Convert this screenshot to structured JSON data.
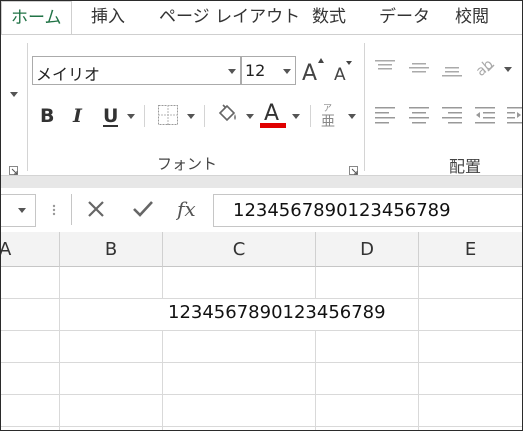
{
  "tabs": [
    "ホーム",
    "挿入",
    "ページ レイアウト",
    "数式",
    "データ",
    "校閲"
  ],
  "font_group": {
    "font_name": "メイリオ",
    "font_size": "12",
    "label": "フォント",
    "underline_color": "#e00000"
  },
  "alignment_group": {
    "label": "配置"
  },
  "formula_bar": {
    "fx_label": "fx",
    "value": "1234567890123456789"
  },
  "columns": [
    "A",
    "B",
    "C",
    "D",
    "E"
  ],
  "cells": {
    "C2": "1234567890123456789"
  },
  "colors": {
    "accent": "#217346"
  }
}
